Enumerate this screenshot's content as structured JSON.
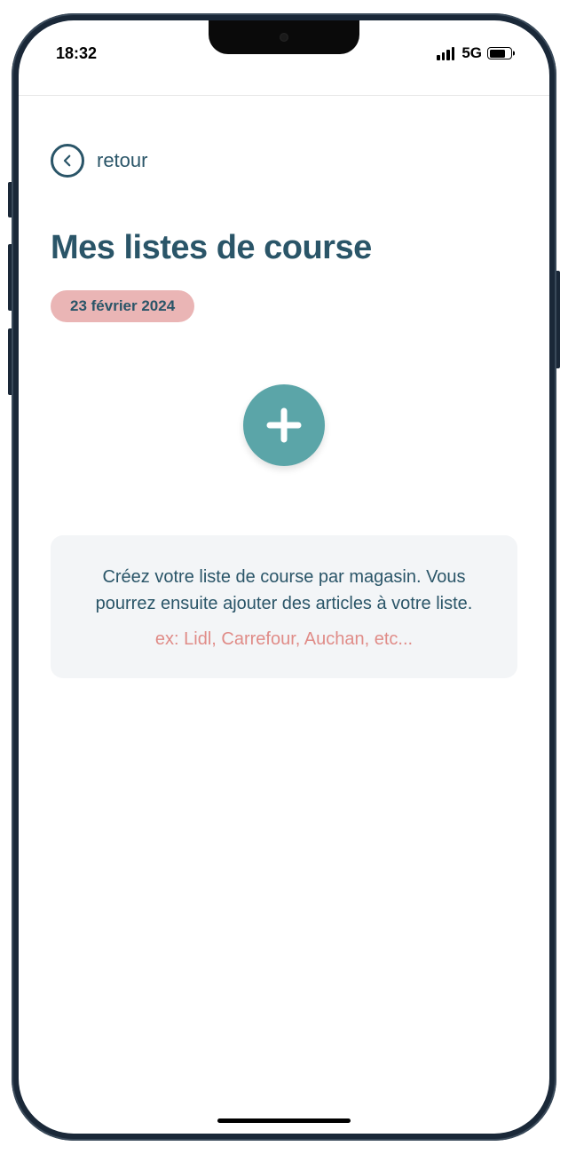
{
  "status": {
    "time": "18:32",
    "network": "5G"
  },
  "nav": {
    "back_label": "retour"
  },
  "page": {
    "title": "Mes listes de course",
    "date": "23 février 2024"
  },
  "info": {
    "text": "Créez votre liste de course par magasin. Vous pourrez ensuite ajouter des articles à votre liste.",
    "example": "ex: Lidl, Carrefour, Auchan, etc..."
  }
}
